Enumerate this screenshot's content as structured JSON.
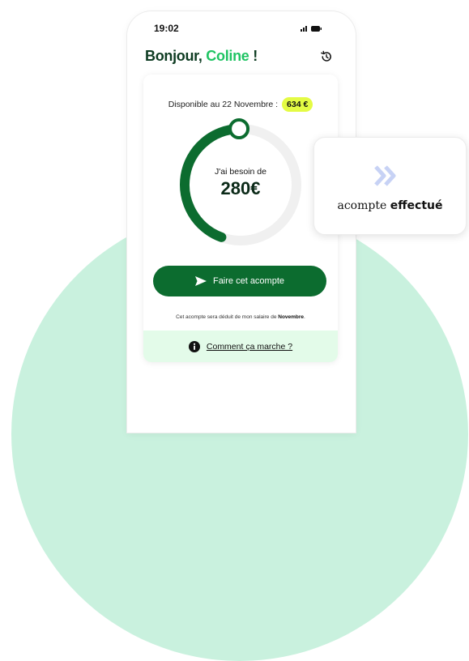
{
  "status_bar": {
    "time": "19:02"
  },
  "header": {
    "greeting_prefix": "Bonjour, ",
    "name": "Coline",
    "greeting_suffix": " !",
    "history_icon": "history-icon"
  },
  "card": {
    "available_text": "Disponible au 22 Novembre :",
    "available_amount": "634 €",
    "need_label": "J'ai besoin de",
    "amount": "280€",
    "gauge_fraction": 0.44,
    "cta_label": "Faire cet acompte",
    "note_prefix": "Cet acompte sera déduit de mon salaire de ",
    "note_month": "Novembre",
    "note_suffix": ".",
    "help_label": "Comment ça marche ?"
  },
  "toast": {
    "word1": "acompte ",
    "word2": "effectué"
  },
  "colors": {
    "brand_dark_green": "#0c6c2f",
    "accent_green": "#1fc463",
    "badge_yellow": "#e4fb44",
    "toast_icon_blue": "#c7d2f5"
  }
}
